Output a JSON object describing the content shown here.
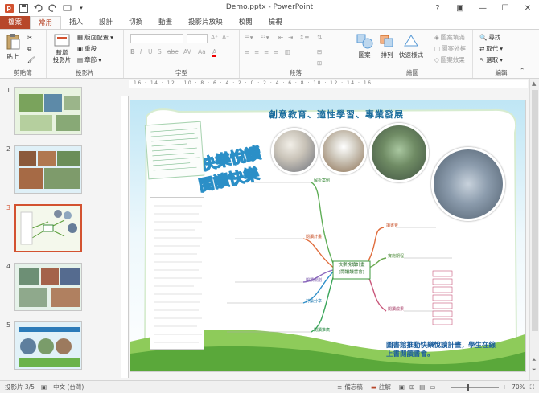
{
  "window": {
    "title": "Demo.pptx - PowerPoint"
  },
  "tabs": [
    {
      "label": "檔案"
    },
    {
      "label": "常用"
    },
    {
      "label": "插入"
    },
    {
      "label": "設計"
    },
    {
      "label": "切換"
    },
    {
      "label": "動畫"
    },
    {
      "label": "投影片放映"
    },
    {
      "label": "校閱"
    },
    {
      "label": "檢視"
    }
  ],
  "ribbon": {
    "clipboard": {
      "paste": "貼上",
      "label": "剪貼簿"
    },
    "slides": {
      "new_slide": "新增\n投影片",
      "layout": "版面配置",
      "reset": "重設",
      "section": "章節",
      "label": "投影片"
    },
    "font": {
      "label": "字型"
    },
    "paragraph": {
      "label": "段落"
    },
    "drawing": {
      "shapes": "圖案",
      "arrange": "排列",
      "quick_styles": "快速樣式",
      "fill": "圖案填滿",
      "outline": "圖案外框",
      "effects": "圖案效果",
      "label": "繪圖"
    },
    "editing": {
      "find": "尋找",
      "replace": "取代",
      "select": "選取",
      "label": "編輯"
    }
  },
  "thumbnails": [
    {
      "num": "1"
    },
    {
      "num": "2"
    },
    {
      "num": "3"
    },
    {
      "num": "4"
    },
    {
      "num": "5"
    }
  ],
  "ruler": {
    "marks": "16 · 14 · 12 · 10 · 8 · 6 · 4 · 2 · 0 · 2 · 4 · 6 · 8 · 10 · 12 · 14 · 16"
  },
  "slide": {
    "headline": "創意教育、適性學習、專業發展",
    "title_art_1": "快樂悅讀",
    "title_art_2": "閱讀快樂",
    "center_node_1": "快樂悅讀計畫",
    "center_node_2": "(閱讀讀書會)",
    "branches": [
      "解析案例",
      "閱讀計畫",
      "閱讀規劃",
      "討論分享",
      "閱讀推廣",
      "讀書會",
      "實施期程",
      "閱讀成果"
    ],
    "footer_text": "圖書館推動快樂悅讀計畫，學生在線上書閱讀書會。"
  },
  "status": {
    "slide_pos": "投影片 3/5",
    "language": "中文 (台灣)",
    "notes": "備忘稿",
    "comments": "註解",
    "zoom": "70%"
  },
  "colors": {
    "accent": "#b7472a",
    "selected_thumb": "#d35230"
  }
}
